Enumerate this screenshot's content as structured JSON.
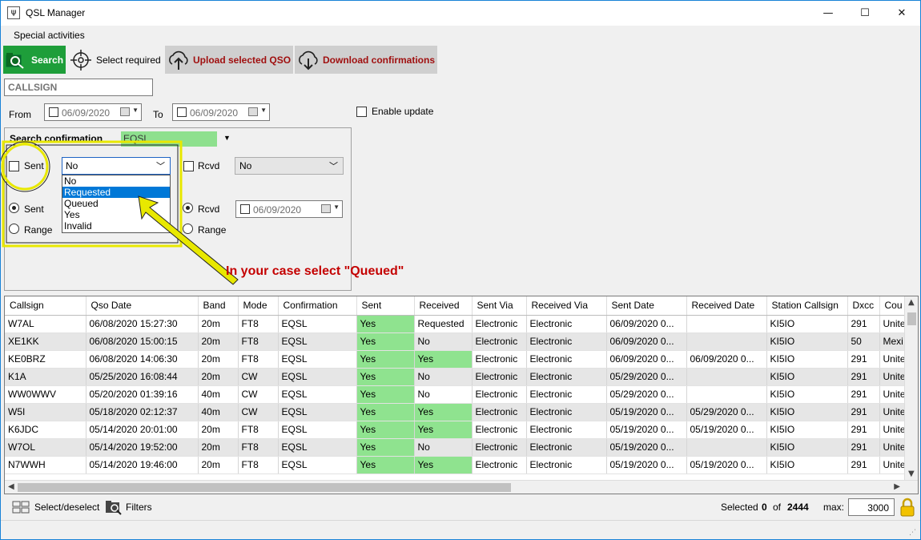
{
  "window": {
    "title": "QSL Manager",
    "controls": {
      "minimize": "—",
      "maximize": "☐",
      "close": "✕"
    }
  },
  "menu": {
    "special_activities": "Special activities"
  },
  "toolbar": {
    "search": "Search",
    "select_required": "Select required",
    "upload": "Upload selected QSO",
    "download": "Download confirmations"
  },
  "filters": {
    "callsign_placeholder": "CALLSIGN",
    "from_label": "From",
    "from_date": "06/09/2020",
    "to_label": "To",
    "to_date": "06/09/2020",
    "enable_update": "Enable update"
  },
  "confirmation": {
    "title": "Search confirmation",
    "type_value": "EQSL",
    "sent_label": "Sent",
    "sent_value": "No",
    "rcvd_label": "Rcvd",
    "rcvd_value": "No",
    "sent_radio": "Sent",
    "range_radio": "Range",
    "rcvd_radio": "Rcvd",
    "range_radio2": "Range",
    "rcvd_date": "06/09/2020",
    "dropdown_options": [
      "No",
      "Requested",
      "Queued",
      "Yes",
      "Invalid"
    ],
    "highlighted_option": "Requested"
  },
  "annotation": {
    "text": "In your case select \"Queued\""
  },
  "table": {
    "columns": [
      "Callsign",
      "Qso Date",
      "Band",
      "Mode",
      "Confirmation",
      "Sent",
      "Received",
      "Sent Via",
      "Received Via",
      "Sent Date",
      "Received Date",
      "Station Callsign",
      "Dxcc",
      "Cou"
    ],
    "rows": [
      [
        "W7AL",
        "06/08/2020 15:27:30",
        "20m",
        "FT8",
        "EQSL",
        "Yes",
        "Requested",
        "Electronic",
        "Electronic",
        "06/09/2020 0...",
        "",
        "KI5IO",
        "291",
        "Unite"
      ],
      [
        "XE1KK",
        "06/08/2020 15:00:15",
        "20m",
        "FT8",
        "EQSL",
        "Yes",
        "No",
        "Electronic",
        "Electronic",
        "06/09/2020 0...",
        "",
        "KI5IO",
        "50",
        "Mexi"
      ],
      [
        "KE0BRZ",
        "06/08/2020 14:06:30",
        "20m",
        "FT8",
        "EQSL",
        "Yes",
        "Yes",
        "Electronic",
        "Electronic",
        "06/09/2020 0...",
        "06/09/2020 0...",
        "KI5IO",
        "291",
        "Unite"
      ],
      [
        "K1A",
        "05/25/2020 16:08:44",
        "20m",
        "CW",
        "EQSL",
        "Yes",
        "No",
        "Electronic",
        "Electronic",
        "05/29/2020 0...",
        "",
        "KI5IO",
        "291",
        "Unite"
      ],
      [
        "WW0WWV",
        "05/20/2020 01:39:16",
        "40m",
        "CW",
        "EQSL",
        "Yes",
        "No",
        "Electronic",
        "Electronic",
        "05/29/2020 0...",
        "",
        "KI5IO",
        "291",
        "Unite"
      ],
      [
        "W5I",
        "05/18/2020 02:12:37",
        "40m",
        "CW",
        "EQSL",
        "Yes",
        "Yes",
        "Electronic",
        "Electronic",
        "05/19/2020 0...",
        "05/29/2020 0...",
        "KI5IO",
        "291",
        "Unite"
      ],
      [
        "K6JDC",
        "05/14/2020 20:01:00",
        "20m",
        "FT8",
        "EQSL",
        "Yes",
        "Yes",
        "Electronic",
        "Electronic",
        "05/19/2020 0...",
        "05/19/2020 0...",
        "KI5IO",
        "291",
        "Unite"
      ],
      [
        "W7OL",
        "05/14/2020 19:52:00",
        "20m",
        "FT8",
        "EQSL",
        "Yes",
        "No",
        "Electronic",
        "Electronic",
        "05/19/2020 0...",
        "",
        "KI5IO",
        "291",
        "Unite"
      ],
      [
        "N7WWH",
        "05/14/2020 19:46:00",
        "20m",
        "FT8",
        "EQSL",
        "Yes",
        "Yes",
        "Electronic",
        "Electronic",
        "05/19/2020 0...",
        "05/19/2020 0...",
        "KI5IO",
        "291",
        "Unite"
      ]
    ],
    "green_color": "#8fe38f",
    "alt_row_color": "#e6e6e6"
  },
  "status": {
    "select_deselect": "Select/deselect",
    "filters": "Filters",
    "selected_label": "Selected",
    "selected_count": "0",
    "of_label": "of",
    "total": "2444",
    "max_label": "max:",
    "max_value": "3000"
  },
  "colors": {
    "search_green": "#1e9e3a",
    "action_red": "#a01010",
    "highlight_yellow": "#ffff00",
    "annotation_red": "#c40000"
  },
  "icons": [
    "app-icon",
    "search-icon",
    "crosshair-icon",
    "upload-cloud-icon",
    "download-cloud-icon",
    "calendar-icon",
    "grid-select-icon",
    "filter-search-icon",
    "lock-icon"
  ]
}
